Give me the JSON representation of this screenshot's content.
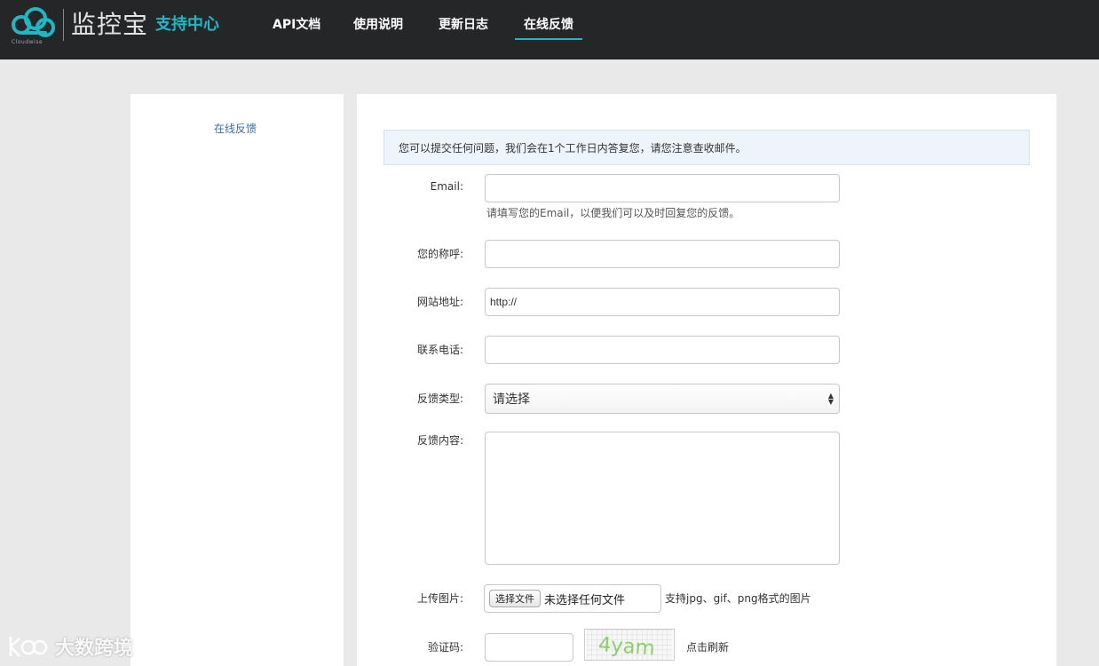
{
  "header": {
    "brand": "监控宝",
    "brand_sub": "支持中心",
    "logo_text": "Cloudwise",
    "nav": [
      {
        "label": "API文档"
      },
      {
        "label": "使用说明"
      },
      {
        "label": "更新日志"
      },
      {
        "label": "在线反馈",
        "active": true
      }
    ],
    "accent_color": "#20b7c5"
  },
  "sidebar": {
    "items": [
      {
        "label": "在线反馈"
      }
    ]
  },
  "form": {
    "notice": "您可以提交任何问题，我们会在1个工作日内答复您，请您注意查收邮件。",
    "email": {
      "label": "Email:",
      "value": "",
      "help": "请填写您的Email，以便我们可以及时回复您的反馈。"
    },
    "name": {
      "label": "您的称呼:",
      "value": ""
    },
    "website": {
      "label": "网站地址:",
      "value": "http://"
    },
    "phone": {
      "label": "联系电话:",
      "value": ""
    },
    "type": {
      "label": "反馈类型:",
      "selected": "请选择"
    },
    "content": {
      "label": "反馈内容:",
      "value": ""
    },
    "upload": {
      "label": "上传图片:",
      "button": "选择文件",
      "status": "未选择任何文件",
      "hint": "支持jpg、gif、png格式的图片"
    },
    "captcha": {
      "label": "验证码:",
      "image_text": "4yam",
      "refresh": "点击刷新"
    }
  },
  "watermark": {
    "text": "大数跨境"
  }
}
